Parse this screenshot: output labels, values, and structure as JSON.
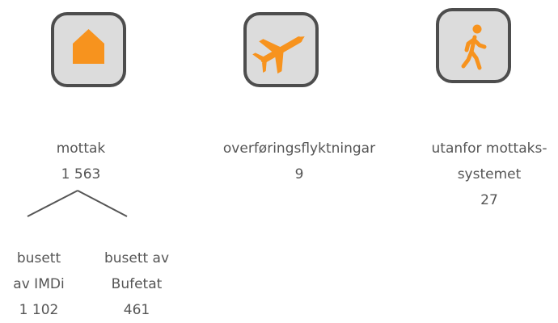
{
  "icons": {
    "house": "house-icon",
    "plane": "airplane-icon",
    "walk": "walking-person-icon",
    "accent": "#f7931e",
    "box_fill": "#dcdcdc",
    "box_border": "#4d4d4d"
  },
  "mottak": {
    "label": "mottak",
    "value": "1 563"
  },
  "overforing": {
    "label": "overføringsflyktningar",
    "value": "9"
  },
  "utanfor": {
    "label_line1": "utanfor mottaks-",
    "label_line2": "systemet",
    "value": "27"
  },
  "busett_imdi": {
    "label_line1": "busett",
    "label_line2": "av IMDi",
    "value": "1 102"
  },
  "busett_bufetat": {
    "label_line1": "busett av",
    "label_line2": "Bufetat",
    "value": "461"
  },
  "text_color": "#555555",
  "line_color": "#555555"
}
